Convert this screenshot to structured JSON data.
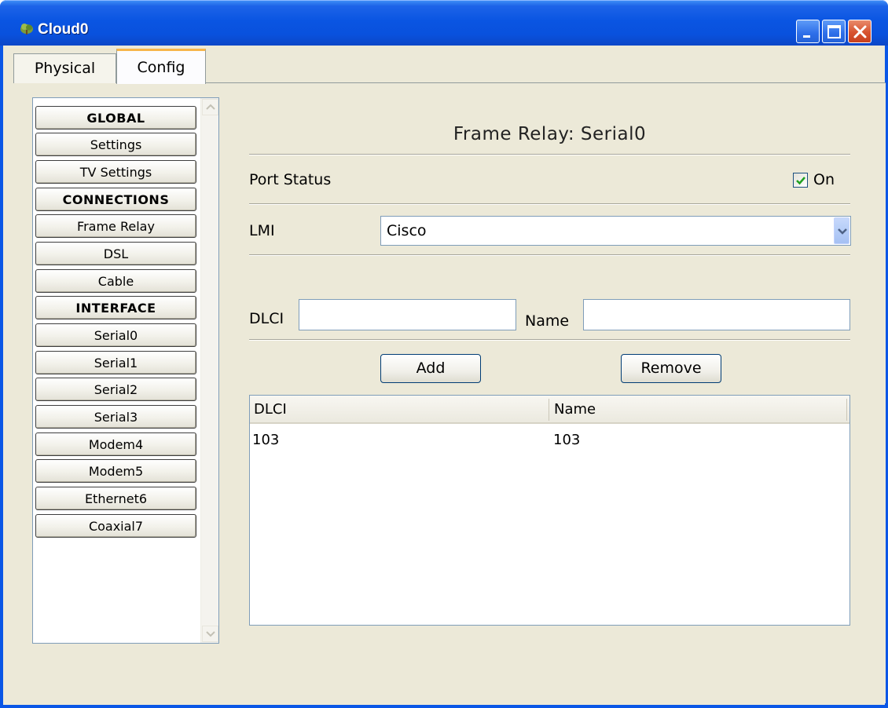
{
  "window": {
    "title": "Cloud0",
    "icon": "cloud-icon",
    "controls": [
      "minimize-icon",
      "maximize-icon",
      "close-icon"
    ]
  },
  "tabs": [
    {
      "label": "Physical",
      "active": false
    },
    {
      "label": "Config",
      "active": true
    }
  ],
  "sidebar": {
    "items": [
      {
        "label": "GLOBAL",
        "header": true
      },
      {
        "label": "Settings",
        "header": false
      },
      {
        "label": "TV Settings",
        "header": false
      },
      {
        "label": "CONNECTIONS",
        "header": true
      },
      {
        "label": "Frame Relay",
        "header": false
      },
      {
        "label": "DSL",
        "header": false
      },
      {
        "label": "Cable",
        "header": false
      },
      {
        "label": "INTERFACE",
        "header": true
      },
      {
        "label": "Serial0",
        "header": false
      },
      {
        "label": "Serial1",
        "header": false
      },
      {
        "label": "Serial2",
        "header": false
      },
      {
        "label": "Serial3",
        "header": false
      },
      {
        "label": "Modem4",
        "header": false
      },
      {
        "label": "Modem5",
        "header": false
      },
      {
        "label": "Ethernet6",
        "header": false
      },
      {
        "label": "Coaxial7",
        "header": false
      }
    ]
  },
  "panel": {
    "title": "Frame Relay: Serial0",
    "port_status_label": "Port Status",
    "port_status_checked": true,
    "port_status_on_label": "On",
    "lmi_label": "LMI",
    "lmi_value": "Cisco",
    "dlci_label": "DLCI",
    "dlci_value": "",
    "name_label": "Name",
    "name_value": "",
    "add_label": "Add",
    "remove_label": "Remove",
    "table": {
      "columns": [
        "DLCI",
        "Name"
      ],
      "rows": [
        [
          "103",
          "103"
        ]
      ]
    }
  },
  "colors": {
    "titlebar": "#0a55e2",
    "window_bg": "#ece9d8",
    "tab_accent": "#f7b64a",
    "checkmark": "#21a121"
  }
}
